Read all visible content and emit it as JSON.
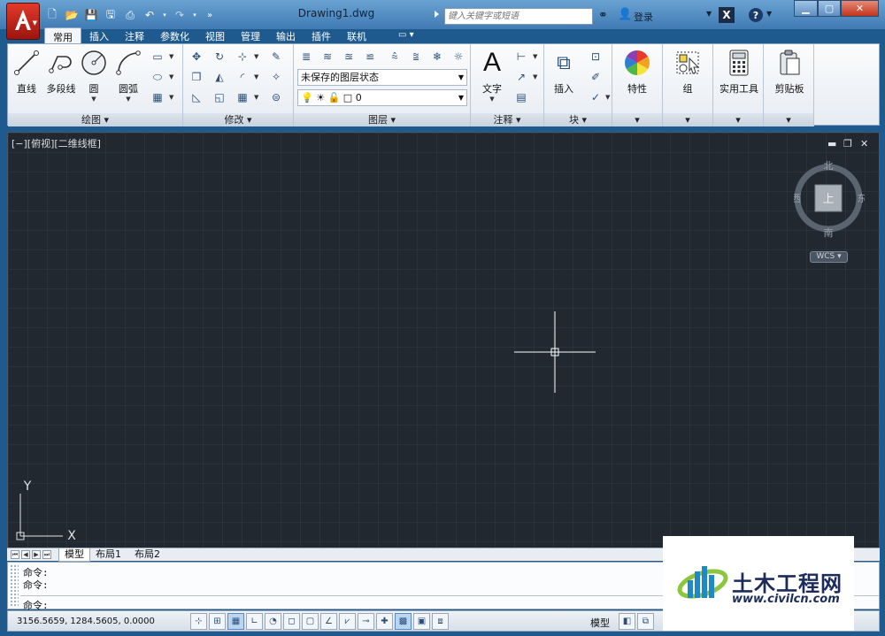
{
  "title_bar": {
    "document_title": "Drawing1.dwg",
    "search_placeholder": "键入关键字或短语",
    "login_label": "登录"
  },
  "ribbon_tabs": [
    "常用",
    "插入",
    "注释",
    "参数化",
    "视图",
    "管理",
    "输出",
    "插件",
    "联机"
  ],
  "active_tab": "常用",
  "ribbon": {
    "draw": {
      "title": "绘图",
      "line": "直线",
      "polyline": "多段线",
      "circle": "圆",
      "arc": "圆弧"
    },
    "modify": {
      "title": "修改"
    },
    "layers": {
      "title": "图层",
      "layer_state": "未保存的图层状态",
      "current_layer": "0"
    },
    "annotation": {
      "title": "注释",
      "text": "文字"
    },
    "block": {
      "title": "块",
      "insert": "插入"
    },
    "properties": {
      "label": "特性"
    },
    "groups": {
      "label": "组"
    },
    "utilities": {
      "label": "实用工具"
    },
    "clipboard": {
      "label": "剪贴板"
    }
  },
  "viewport": {
    "controls_label": "[−][俯视][二维线框]",
    "viewcube": {
      "north": "北",
      "south": "南",
      "east": "东",
      "west": "西",
      "face": "上"
    },
    "wcs_label": "WCS",
    "ucs_y": "Y",
    "ucs_x": "X"
  },
  "layout_tabs": [
    "模型",
    "布局1",
    "布局2"
  ],
  "active_layout": "模型",
  "command": {
    "history": [
      "命令:",
      "命令:"
    ],
    "prompt": "命令:"
  },
  "status": {
    "coordinates": "3156.5659,  1284.5605,  0.0000",
    "model_label": "模型"
  },
  "watermark": {
    "title": "土木工程网",
    "url": "www.civilcn.com"
  },
  "colors": {
    "titlebar": "#4f8bc4",
    "viewport_bg": "#212830",
    "app_button": "#c62a1c",
    "watermark_text": "#1c2c5a"
  }
}
